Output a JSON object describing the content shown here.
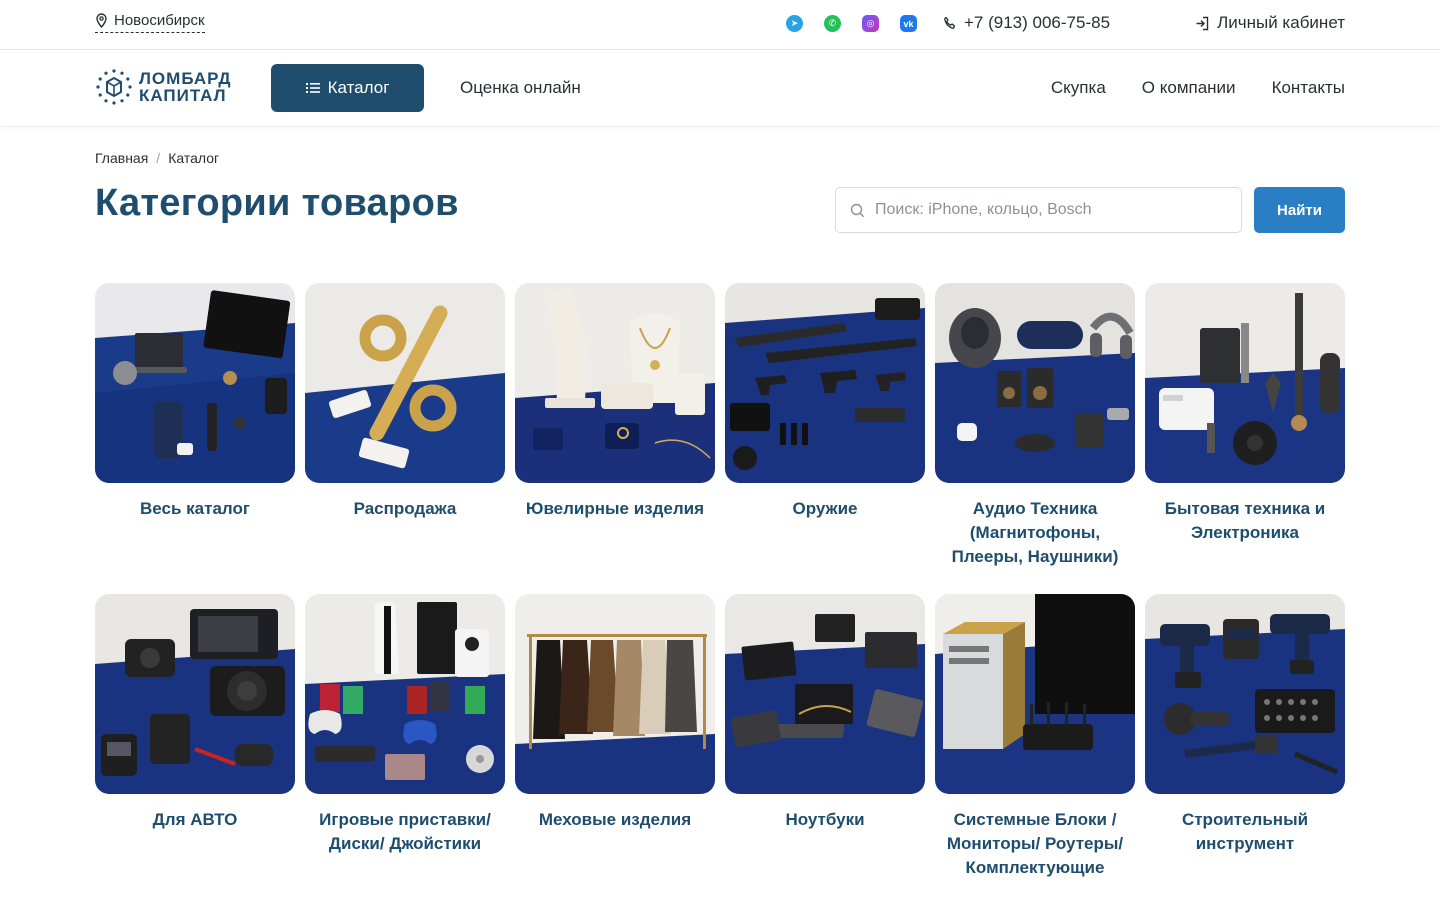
{
  "topbar": {
    "city": "Новосибирск",
    "phone": "+7 (913) 006-75-85",
    "cabinet": "Личный кабинет",
    "socials": [
      {
        "icon": "telegram-icon",
        "color": "#2aa3e0"
      },
      {
        "icon": "whatsapp-icon",
        "color": "#25c05a"
      },
      {
        "icon": "instagram-icon",
        "color": "#8a4ff0"
      },
      {
        "icon": "vk-icon",
        "color": "#1f77f2"
      }
    ]
  },
  "header": {
    "logo_line1": "ЛОМБАРД",
    "logo_line2": "КАПИТАЛ",
    "catalog_button": "Каталог",
    "nav_online": "Оценка онлайн",
    "nav": [
      "Скупка",
      "О компании",
      "Контакты"
    ]
  },
  "breadcrumb": {
    "home": "Главная",
    "sep": "/",
    "current": "Каталог"
  },
  "page": {
    "title": "Категории товаров"
  },
  "search": {
    "placeholder": "Поиск: iPhone, кольцо, Bosch",
    "button": "Найти"
  },
  "categories": [
    {
      "label": "Весь каталог",
      "scene": "mixed"
    },
    {
      "label": "Распродажа",
      "scene": "sale"
    },
    {
      "label": "Ювелирные изделия",
      "scene": "jewelry"
    },
    {
      "label": "Оружие",
      "scene": "weapons"
    },
    {
      "label": "Аудио Техника (Магнитофоны, Плееры, Наушники)",
      "scene": "audio"
    },
    {
      "label": "Бытовая техника и Электроника",
      "scene": "appliances"
    },
    {
      "label": "Для АВТО",
      "scene": "auto"
    },
    {
      "label": "Игровые приставки/ Диски/ Джойстики",
      "scene": "gaming"
    },
    {
      "label": "Меховые изделия",
      "scene": "fur"
    },
    {
      "label": "Ноутбуки",
      "scene": "laptops"
    },
    {
      "label": "Системные Блоки / Мониторы/ Роутеры/ Комплектующие",
      "scene": "pc"
    },
    {
      "label": "Строительный инструмент",
      "scene": "tools"
    }
  ],
  "colors": {
    "brand": "#1e4d6e",
    "accent": "#2a7ec4",
    "carpet": "#15307a"
  }
}
